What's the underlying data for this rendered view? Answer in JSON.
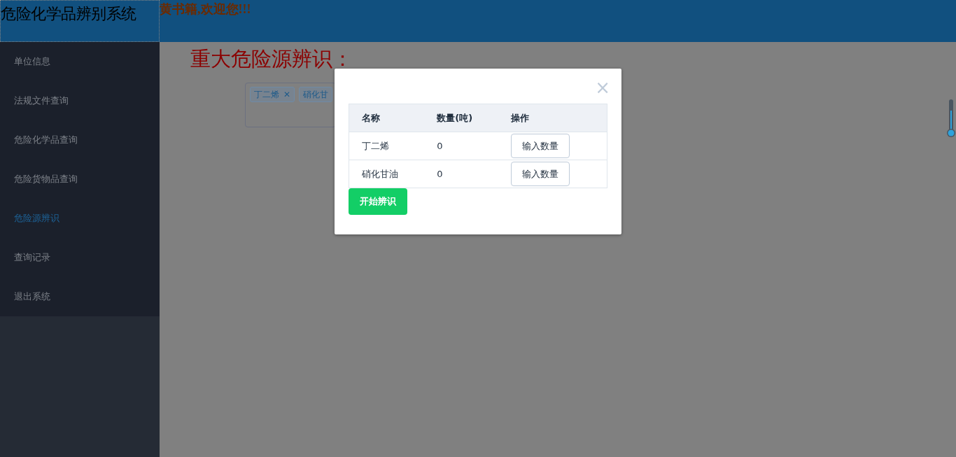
{
  "header": {
    "title": "危险化学品辨别系统",
    "welcome": "黄书籍,欢迎您!!!"
  },
  "sidebar": {
    "items": [
      {
        "label": "单位信息",
        "selected": false
      },
      {
        "label": "法规文件查询",
        "selected": false
      },
      {
        "label": "危险化学品查询",
        "selected": false
      },
      {
        "label": "危险货物品查询",
        "selected": false
      },
      {
        "label": "危险源辨识",
        "selected": true
      },
      {
        "label": "查询记录",
        "selected": false
      },
      {
        "label": "退出系统",
        "selected": false
      }
    ]
  },
  "main": {
    "heading": "重大危险源辨识：",
    "tags": [
      {
        "label": "丁二烯",
        "close": "✕"
      },
      {
        "label": "硝化甘"
      }
    ]
  },
  "modal": {
    "close": "×",
    "table": {
      "columns": [
        "名称",
        "数量(吨)",
        "操作"
      ],
      "rows": [
        {
          "name": "丁二烯",
          "quantity": "0",
          "action": "输入数量"
        },
        {
          "name": "硝化甘油",
          "quantity": "0",
          "action": "输入数量"
        }
      ]
    },
    "submit": "开始辨识"
  }
}
